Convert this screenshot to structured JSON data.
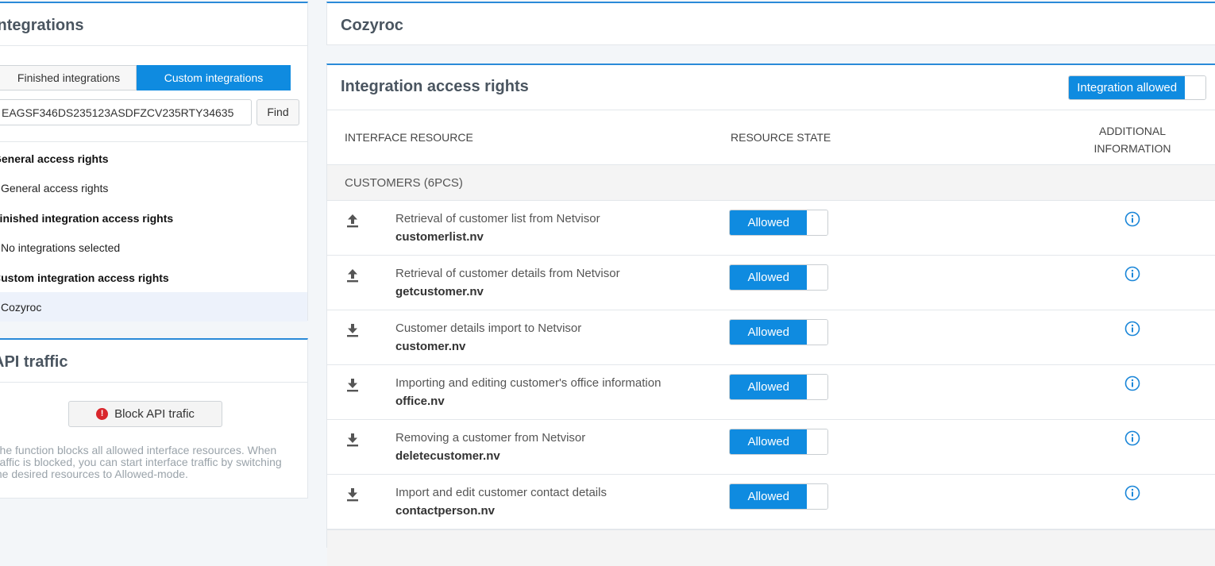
{
  "left": {
    "title": "Integrations",
    "tabs": [
      {
        "label": "Finished integrations",
        "active": false
      },
      {
        "label": "Custom integrations",
        "active": true
      }
    ],
    "search": {
      "value": "EAGSF346DS235123ASDFZCV235RTY34635",
      "find_label": "Find"
    },
    "nav": {
      "general_heading": "General access rights",
      "general_item": "General access rights",
      "finished_heading": "Finished integration access rights",
      "finished_item": "No integrations selected",
      "custom_heading": "Custom integration access rights",
      "custom_item": "Cozyroc"
    }
  },
  "api": {
    "title": "API traffic",
    "block_label": "Block API trafic",
    "help_text": "The function blocks all allowed interface resources. When traffic is blocked, you can start interface traffic by switching the desired resources to Allowed-mode."
  },
  "right": {
    "header_title": "Cozyroc",
    "main_title": "Integration access rights",
    "integration_toggle": "Integration allowed",
    "columns": {
      "resource": "INTERFACE RESOURCE",
      "state": "RESOURCE STATE",
      "info_line1": "ADDITIONAL",
      "info_line2": "INFORMATION"
    },
    "section_label": "CUSTOMERS (6PCS)",
    "rows": [
      {
        "direction": "upload-icon",
        "description": "Retrieval of customer list from Netvisor",
        "file": "customerlist.nv",
        "state": "Allowed"
      },
      {
        "direction": "upload-icon",
        "description": "Retrieval of customer details from Netvisor",
        "file": "getcustomer.nv",
        "state": "Allowed"
      },
      {
        "direction": "download-icon",
        "description": "Customer details import to Netvisor",
        "file": "customer.nv",
        "state": "Allowed"
      },
      {
        "direction": "download-icon",
        "description": "Importing and editing customer's office information",
        "file": "office.nv",
        "state": "Allowed"
      },
      {
        "direction": "download-icon",
        "description": "Removing a customer from Netvisor",
        "file": "deletecustomer.nv",
        "state": "Allowed"
      },
      {
        "direction": "download-icon",
        "description": "Import and edit customer contact details",
        "file": "contactperson.nv",
        "state": "Allowed"
      }
    ]
  },
  "colors": {
    "accent": "#0f8be0",
    "panel_border": "#2a8ad8",
    "alert": "#d9262c"
  }
}
